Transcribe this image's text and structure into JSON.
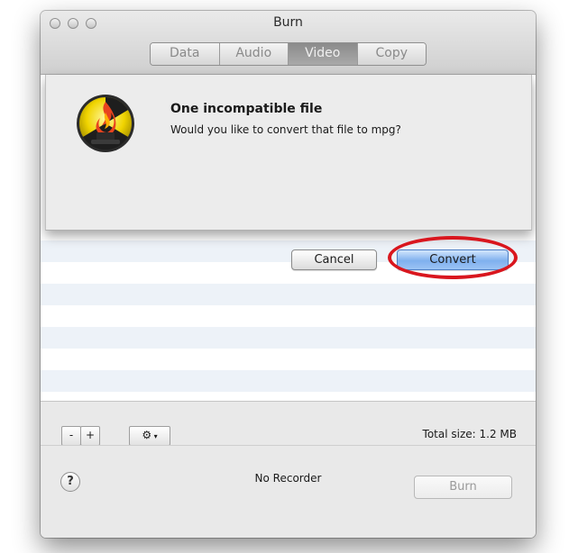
{
  "window": {
    "title": "Burn"
  },
  "tabs": [
    {
      "label": "Data",
      "active": false
    },
    {
      "label": "Audio",
      "active": false
    },
    {
      "label": "Video",
      "active": true
    },
    {
      "label": "Copy",
      "active": false
    }
  ],
  "sheet": {
    "title": "One incompatible file",
    "message": "Would you like to convert that file to mpg?",
    "cancel_label": "Cancel",
    "convert_label": "Convert",
    "icon": "burn-app-icon"
  },
  "annotation": {
    "color": "#d9161e",
    "target": "convert-button"
  },
  "toolbar": {
    "remove_label": "-",
    "add_label": "+",
    "gear_icon": "gear-icon",
    "total_size": "Total size: 1.2 MB"
  },
  "footer": {
    "help_label": "?",
    "recorder_status": "No Recorder",
    "burn_label": "Burn"
  },
  "colors": {
    "accent": "#7fb0ee",
    "stripe": "#edf2f8"
  }
}
